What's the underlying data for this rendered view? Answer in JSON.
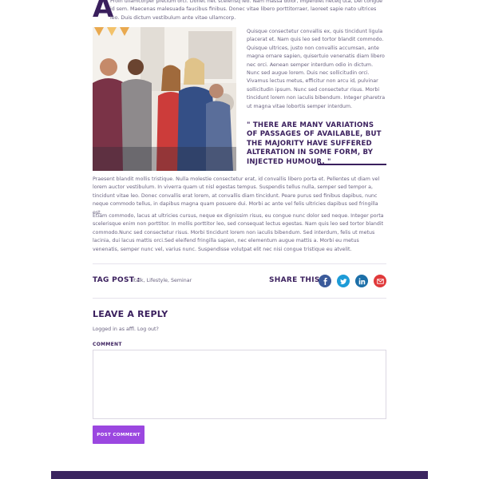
{
  "article": {
    "drop_cap": "A",
    "intro": "Proin ullamcorper pretium orci. Donec nec scelerisq leo. Nam massa dolor, imperdiet neceq uta, Del congue id sem. Maecenas malesuada faucibus finibus. Donec vitae libero porttitorraer, laoreet sapie nato ultrices leo. Duis dictum vestibulum ante vitae ullamcorp.",
    "side_text": "Quisque consectetur convallis ex, quis tincidunt ligula placerat et. Nam quis leo sed tortor blandit commodo. Quisque ultrices, justo non convallis accumsan, ante magna ornare sapien, quisertuio venenatis diam libero nec orci. Aenean semper interdum odio in dictum. Nunc sed augue lorem. Duis nec sollicitudin orci. Vivamus lectus metus, efficitur non arcu id, pulvinar sollicitudin ipsum. Nunc sed consectetur risus. Morbi tincidunt lorem non iaculis bibendum. Integer pharetra ut magna vitae lobortis semper interdum.",
    "quote": "\" There are many variations of passages of available, but the majority have suffered alteration in some form, by injected humour. \"",
    "paragraph1": "Praesent blandit mollis tristique. Nulla molestie consectetur erat, id convallis libero porta et. Pellentes ut diam vel lorem auctor vestibulum. In viverra quam ut nisl egestas tempus. Suspendis tellus nulla, semper sed tempor a, tincidunt vitae leo. Donec convallis erat lorem, at convallis diam tincidunt. Peare purus sed finibus dapibus, nunc neque commodo tellus, in dapibus magna quam posuere dui. Morbi ac ante vel felis ultricies dapibus sed fringilla est.",
    "paragraph2": "Etiam commodo, lacus at ultricies cursus, neque ex dignissim risus, eu congue nunc dolor sed neque. Integer porta scelerisque enim non porttitor. In mollis porttitor leo, sed consequat lectus egestas. Nam quis leo sed tortor blandit commodo.Nunc sed consectetur risus. Morbi tincidunt lorem non iaculis bibendum. Sed interdum, felis ut metus lacinia, dui lacus mattis orci.Sed eleifend fringilla sapien, nec elementum augue mattis a. Morbi eu metus venenatis, semper nunc vel, varius nunc. Suspendisse volutpat elit nec nisi congue tristique eu atvelit."
  },
  "tags": {
    "label": "TAG POST :",
    "items": "Italk, Lifestyle, Seminar"
  },
  "share": {
    "label": "SHARE THIS :",
    "icons": [
      "facebook-icon",
      "twitter-icon",
      "linkedin-icon",
      "email-icon"
    ],
    "colors": [
      "#3b5a9a",
      "#1d9bd7",
      "#1c6fa8",
      "#e0393a"
    ]
  },
  "reply": {
    "title": "Leave A Reply",
    "logged_in": "Logged in as affl. Log out?",
    "comment_label": "COMMENT",
    "comment_value": "",
    "submit_label": "POST COMMENT"
  },
  "colors": {
    "heading": "#3a1f5d",
    "button": "#9b47e0",
    "footer": "#3b2560"
  }
}
